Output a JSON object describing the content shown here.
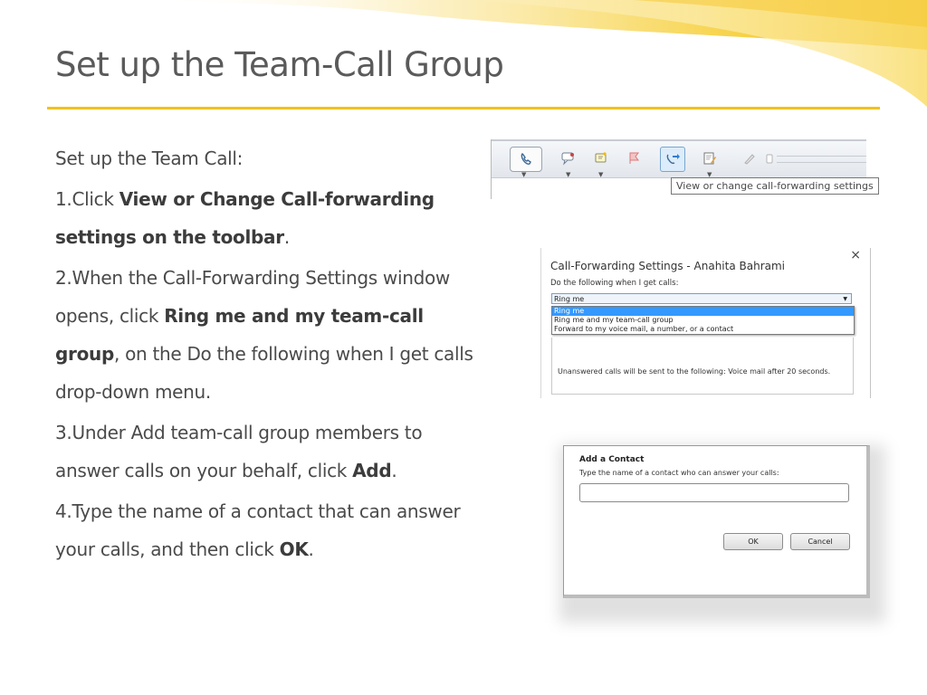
{
  "colors": {
    "accent": "#f2c21b",
    "title": "#5a5a5a",
    "body": "#4a4a4a"
  },
  "slide": {
    "title": "Set up the Team-Call Group",
    "intro": "Set up the Team Call:",
    "step1": {
      "prefix": "1.Click ",
      "bold": "View or Change Call-forwarding settings on the toolbar",
      "suffix": "."
    },
    "step2": {
      "prefix": "2.When the Call-Forwarding Settings window opens, click ",
      "bold": "Ring me and my team-call group",
      "suffix": ", on the Do the following when I get calls drop-down menu."
    },
    "step3": {
      "prefix": "3.Under Add team-call group members to answer calls on your behalf, click ",
      "bold": "Add",
      "suffix": "."
    },
    "step4": {
      "prefix": "4.Type the name of a contact that can answer your calls, and then click ",
      "bold": "OK",
      "suffix": "."
    }
  },
  "toolbar": {
    "icons": [
      "phone-icon",
      "im-icon",
      "note-icon",
      "flag-icon",
      "call-forward-icon",
      "edit-icon",
      "pen-icon",
      "slider-icon"
    ],
    "tooltip": "View or change call-forwarding settings"
  },
  "call_forwarding_dialog": {
    "title": "Call-Forwarding Settings - Anahita Bahrami",
    "prompt": "Do the following when I get calls:",
    "selected": "Ring me",
    "options": [
      "Ring me",
      "Ring me and my team-call group",
      "Forward to my voice mail, a number, or a contact"
    ],
    "unanswered": "Unanswered calls will be sent to the following: Voice mail after 20 seconds.",
    "close_glyph": "×"
  },
  "add_contact_dialog": {
    "title": "Add a Contact",
    "prompt": "Type the name of a contact who can answer your calls:",
    "ok": "OK",
    "cancel": "Cancel"
  }
}
